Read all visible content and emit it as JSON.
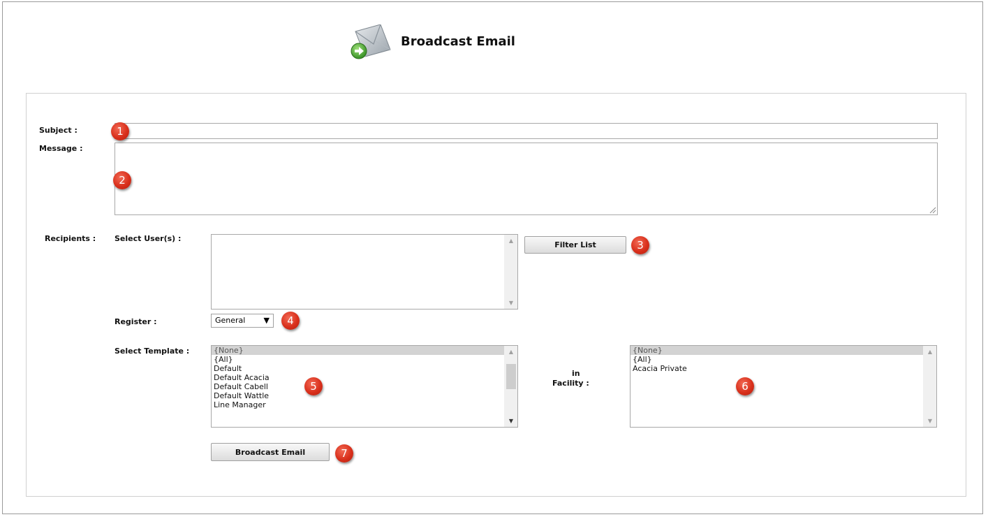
{
  "header": {
    "title": "Broadcast Email",
    "icon": "envelope-send-icon"
  },
  "form": {
    "subject_label": "Subject :",
    "subject_value": "",
    "message_label": "Message :",
    "message_value": "",
    "recipients_label": "Recipients :",
    "select_users_label": "Select User(s) :",
    "users_list": [],
    "filter_button": "Filter List",
    "register_label": "Register :",
    "register_selected": "General",
    "select_template_label": "Select Template :",
    "template_options": [
      "{None}",
      "{All}",
      "Default",
      "Default Acacia",
      "Default Cabell",
      "Default Wattle",
      "Line Manager"
    ],
    "template_selected": "{None}",
    "in_label": "in",
    "facility_label": "Facility :",
    "facility_options": [
      "{None}",
      "{All}",
      "Acacia Private"
    ],
    "facility_selected": "{None}",
    "broadcast_button": "Broadcast Email"
  },
  "markers": [
    "1",
    "2",
    "3",
    "4",
    "5",
    "6",
    "7"
  ],
  "colors": {
    "marker_red": "#d9301c",
    "selected_option_bg": "#d3d3d3",
    "border": "#a8a8a8"
  }
}
